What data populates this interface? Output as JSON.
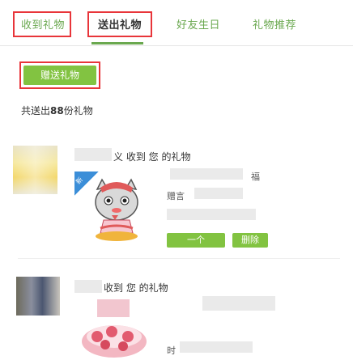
{
  "tabs": {
    "received": "收到礼物",
    "sent": "送出礼物",
    "birthday": "好友生日",
    "recommend": "礼物推荐"
  },
  "send_button": "赠送礼物",
  "summary": {
    "prefix": "共送出",
    "count": "88",
    "suffix": "份礼物"
  },
  "cards": [
    {
      "title_end": "义 收到 您 的礼物",
      "badge": "新",
      "line1_end": "福",
      "line2": "赠言",
      "btn_partial": "一个",
      "delete": "删除"
    },
    {
      "title": "收到 您 的礼物",
      "line_prefix": "时"
    }
  ],
  "colors": {
    "accent": "#82c341",
    "highlight": "#e8353a",
    "tab_text": "#6aa84f"
  }
}
